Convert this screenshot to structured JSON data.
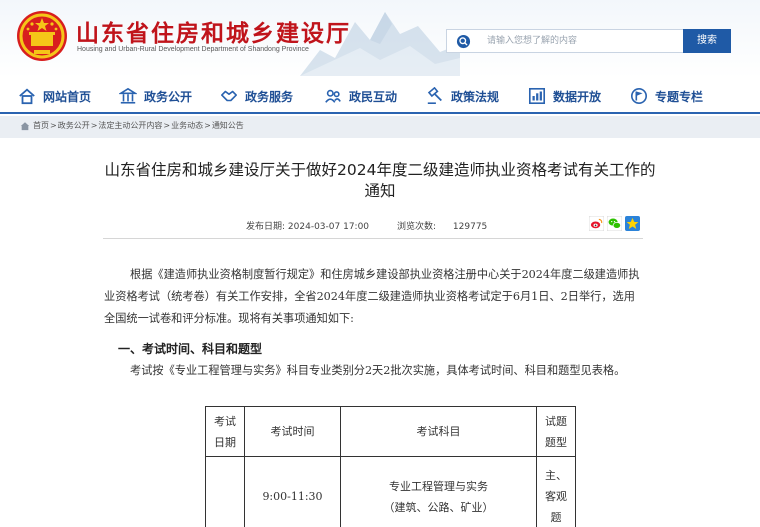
{
  "header": {
    "title": "山东省住房和城乡建设厅",
    "subtitle": "Housing and Urban-Rural Development Department of Shandong Province"
  },
  "search": {
    "placeholder": "请输入您想了解的内容",
    "button_label": "搜索"
  },
  "nav": {
    "items": [
      {
        "label": "网站首页",
        "icon": "home-icon"
      },
      {
        "label": "政务公开",
        "icon": "building-icon"
      },
      {
        "label": "政务服务",
        "icon": "handshake-icon"
      },
      {
        "label": "政民互动",
        "icon": "people-icon"
      },
      {
        "label": "政策法规",
        "icon": "gavel-icon"
      },
      {
        "label": "数据开放",
        "icon": "chart-icon"
      },
      {
        "label": "专题专栏",
        "icon": "flag-icon"
      }
    ]
  },
  "breadcrumb": {
    "items": [
      "首页",
      "政务公开",
      "法定主动公开内容",
      "业务动态",
      "通知公告"
    ],
    "separator": ">"
  },
  "article": {
    "title_line1": "山东省住房和城乡建设厅关于做好2024年度二级建造师执业资格考试有关工作的",
    "title_line2": "通知",
    "publish_label": "发布日期:",
    "publish_date": "2024-03-07 17:00",
    "views_label": "浏览次数:",
    "views": "129775",
    "para1": "根据《建造师执业资格制度暂行规定》和住房城乡建设部执业资格注册中心关于2024年度二级建造师执业资格考试（统考卷）有关工作安排，全省2024年度二级建造师执业资格考试定于6月1日、2日举行，选用全国统一试卷和评分标准。现将有关事项通知如下:",
    "heading1": "一、考试时间、科目和题型",
    "para2": "考试按《专业工程管理与实务》科目专业类别分2天2批次实施，具体考试时间、科目和题型见表格。"
  },
  "table": {
    "headers": [
      "考试日期",
      "考试时间",
      "考试科目",
      "试题题型"
    ],
    "rows": [
      {
        "date": "",
        "time": "9:00-11:30",
        "subject_line1": "专业工程管理与实务",
        "subject_line2": "（建筑、公路、矿业）",
        "type": "主、客观题"
      }
    ]
  },
  "share": {
    "weibo_icon": "weibo-icon",
    "wechat_icon": "wechat-icon",
    "qzone_icon": "qzone-icon"
  },
  "colors": {
    "brand_red": "#c0141b",
    "nav_blue": "#1f4f95",
    "search_button": "#1f5aa6"
  }
}
